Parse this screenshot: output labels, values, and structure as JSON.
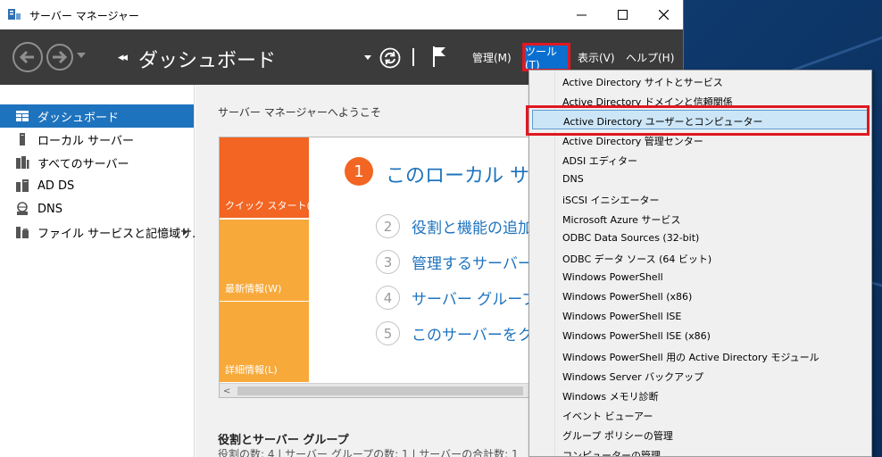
{
  "window": {
    "title": "サーバー マネージャー",
    "minimize_glyph": "—",
    "maximize_glyph": "☐",
    "close_glyph": "✕"
  },
  "navbar": {
    "breadcrumb_arrows": "◂◂",
    "breadcrumb_title": "ダッシュボード",
    "menus": {
      "manage": "管理(M)",
      "tools": "ツール(T)",
      "view": "表示(V)",
      "help": "ヘルプ(H)"
    }
  },
  "sidebar": {
    "items": [
      {
        "label": "ダッシュボード",
        "icon": "dashboard-icon"
      },
      {
        "label": "ローカル サーバー",
        "icon": "local-server-icon"
      },
      {
        "label": "すべてのサーバー",
        "icon": "all-servers-icon"
      },
      {
        "label": "AD DS",
        "icon": "ad-ds-icon"
      },
      {
        "label": "DNS",
        "icon": "dns-icon"
      },
      {
        "label": "ファイル サービスと記憶域サ...",
        "icon": "file-services-icon"
      }
    ]
  },
  "main": {
    "welcome_title": "サーバー マネージャーへようこそ",
    "tiles": {
      "quick": "クイック スタート(Q)",
      "news": "最新情報(W)",
      "learn": "詳細情報(L)"
    },
    "step1": {
      "number": "1",
      "text": "このローカル サーバーの構成"
    },
    "steps": [
      {
        "number": "2",
        "text": "役割と機能の追加"
      },
      {
        "number": "3",
        "text": "管理するサーバーの追加"
      },
      {
        "number": "4",
        "text": "サーバー グループの作成"
      },
      {
        "number": "5",
        "text": "このサーバーをクラウド サービスに接続する"
      }
    ],
    "scroll_left": "<",
    "roles_title": "役割とサーバー グループ",
    "roles_subtitle": "役割の数: 4 | サーバー グループの数: 1 | サーバーの合計数: 1"
  },
  "tools_menu": {
    "items": [
      "Active Directory サイトとサービス",
      "Active Directory ドメインと信頼関係",
      "Active Directory ユーザーとコンピューター",
      "Active Directory 管理センター",
      "ADSI エディター",
      "DNS",
      "iSCSI イニシエーター",
      "Microsoft Azure サービス",
      "ODBC Data Sources (32-bit)",
      "ODBC データ ソース (64 ビット)",
      "Windows PowerShell",
      "Windows PowerShell (x86)",
      "Windows PowerShell ISE",
      "Windows PowerShell ISE (x86)",
      "Windows PowerShell 用の Active Directory モジュール",
      "Windows Server バックアップ",
      "Windows メモリ診断",
      "イベント ビューアー",
      "グループ ポリシーの管理",
      "コンピューターの管理"
    ],
    "highlighted_index": 2
  },
  "colors": {
    "accent_blue": "#1e73be",
    "tile_orange": "#f26522",
    "tile_amber": "#f7a93a",
    "highlight_red": "#e01822"
  }
}
